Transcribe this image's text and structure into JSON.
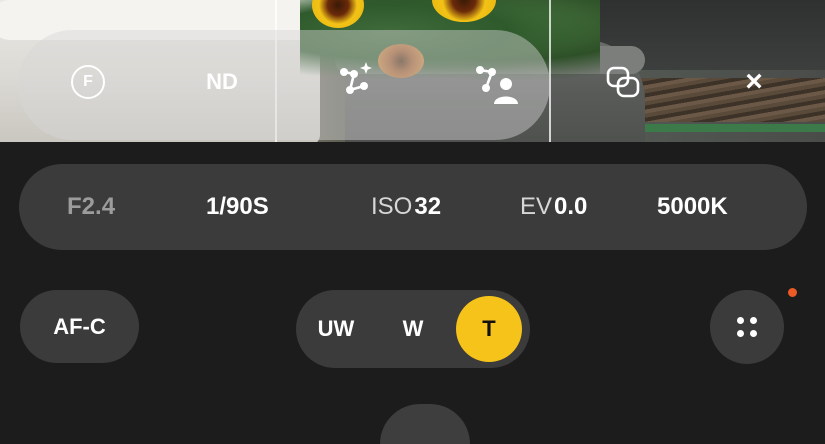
{
  "top_controls": {
    "flash_label": "F",
    "nd_label": "ND",
    "icons": [
      "f-filter-icon",
      "nd-filter-icon",
      "auto-focus-points-icon",
      "subject-focus-icon",
      "overlay-layers-icon",
      "close-icon"
    ],
    "close_glyph": "×"
  },
  "params": {
    "aperture": {
      "label": "F",
      "value": "2.4"
    },
    "shutter": {
      "value": "1/90S"
    },
    "iso": {
      "label": "ISO",
      "value": "32"
    },
    "ev": {
      "label": "EV",
      "value": "0.0"
    },
    "white_balance": {
      "value": "5000K"
    }
  },
  "focus_mode": {
    "label": "AF-C"
  },
  "lenses": {
    "options": [
      {
        "label": "UW",
        "active": false
      },
      {
        "label": "W",
        "active": false
      },
      {
        "label": "T",
        "active": true
      }
    ]
  },
  "colors": {
    "accent": "#f6c31b",
    "notification": "#ee5a24",
    "panel": "#3b3b3b",
    "background": "#1c1c1c"
  }
}
